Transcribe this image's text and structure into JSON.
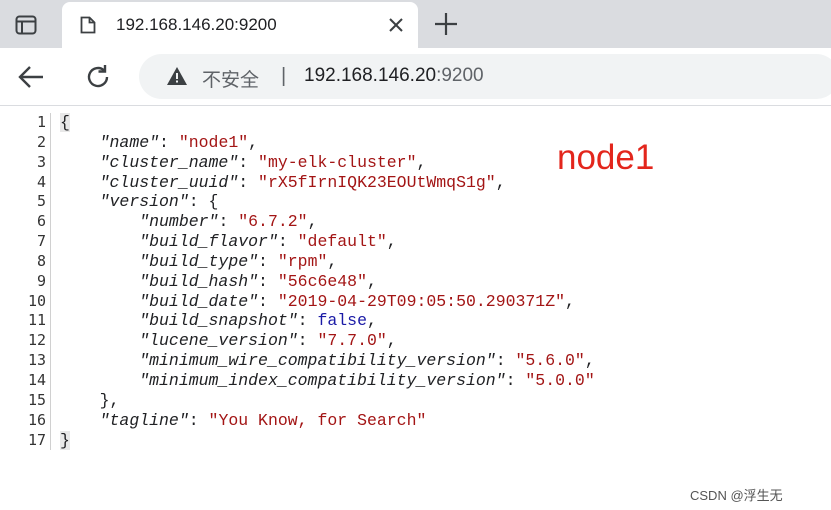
{
  "tab": {
    "title": "192.168.146.20:9200"
  },
  "omnibox": {
    "security_label": "不安全",
    "separator": "|",
    "host": "192.168.146.20",
    "port": ":9200"
  },
  "code": {
    "line_numbers": [
      "1",
      "2",
      "3",
      "4",
      "5",
      "6",
      "7",
      "8",
      "9",
      "10",
      "11",
      "12",
      "13",
      "14",
      "15",
      "16",
      "17"
    ],
    "open_brace": "{",
    "close_brace": "}",
    "name_key": "\"name\"",
    "name_val": "\"node1\"",
    "cluster_name_key": "\"cluster_name\"",
    "cluster_name_val": "\"my-elk-cluster\"",
    "cluster_uuid_key": "\"cluster_uuid\"",
    "cluster_uuid_val": "\"rX5fIrnIQK23EOUtWmqS1g\"",
    "version_key": "\"version\"",
    "number_key": "\"number\"",
    "number_val": "\"6.7.2\"",
    "build_flavor_key": "\"build_flavor\"",
    "build_flavor_val": "\"default\"",
    "build_type_key": "\"build_type\"",
    "build_type_val": "\"rpm\"",
    "build_hash_key": "\"build_hash\"",
    "build_hash_val": "\"56c6e48\"",
    "build_date_key": "\"build_date\"",
    "build_date_val": "\"2019-04-29T09:05:50.290371Z\"",
    "build_snapshot_key": "\"build_snapshot\"",
    "build_snapshot_val": "false",
    "lucene_version_key": "\"lucene_version\"",
    "lucene_version_val": "\"7.7.0\"",
    "min_wire_key": "\"minimum_wire_compatibility_version\"",
    "min_wire_val": "\"5.6.0\"",
    "min_index_key": "\"minimum_index_compatibility_version\"",
    "min_index_val": "\"5.0.0\"",
    "tagline_key": "\"tagline\"",
    "tagline_val": "\"You Know, for Search\""
  },
  "annotation": "node1",
  "watermark": "CSDN @浮生无",
  "icons": {
    "tab_actions": "tab-actions-icon",
    "doc": "document-icon",
    "close": "close-icon",
    "new_tab": "plus-icon",
    "back": "back-arrow-icon",
    "reload": "reload-icon",
    "warning": "warning-icon"
  }
}
